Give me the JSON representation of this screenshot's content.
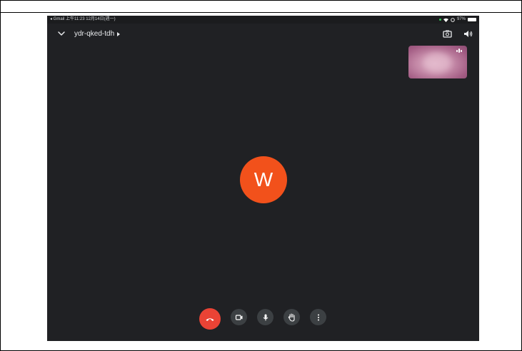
{
  "status_bar": {
    "left_text": "◂ Gmail  上午11:23  12月14日(週一)",
    "battery": "97%"
  },
  "meeting": {
    "code": "ydr-qked-tdh"
  },
  "participant": {
    "initial": "W",
    "avatar_color": "#f2511b"
  },
  "controls": [
    {
      "name": "end-call",
      "icon": "phone-hangup-icon",
      "color": "#ea4335"
    },
    {
      "name": "camera",
      "icon": "video-camera-icon",
      "color": "#3c4043"
    },
    {
      "name": "microphone",
      "icon": "microphone-icon",
      "color": "#3c4043"
    },
    {
      "name": "raise-hand",
      "icon": "hand-icon",
      "color": "#3c4043"
    },
    {
      "name": "more-options",
      "icon": "more-vert-icon",
      "color": "#3c4043"
    }
  ],
  "colors": {
    "background": "#202124",
    "text": "#e8eaed",
    "self_view_tint": "#c58aa8"
  }
}
